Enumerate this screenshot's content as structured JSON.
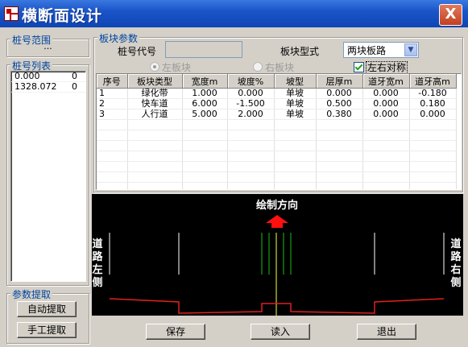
{
  "window": {
    "title": "横断面设计",
    "close_label": "X"
  },
  "left": {
    "stake_range_title": "桩号范围",
    "stake_range_value": "...",
    "stake_list_title": "桩号列表",
    "stake_list": [
      {
        "station": "0.000",
        "value": "0"
      },
      {
        "station": "1328.072",
        "value": "0"
      }
    ],
    "extract_title": "参数提取",
    "auto_extract": "自动提取",
    "manual_extract": "手工提取"
  },
  "params": {
    "title": "板块参数",
    "stake_code_label": "桩号代号",
    "stake_code_value": "",
    "type_label": "板块型式",
    "type_value": "两块板路",
    "left_block": "左板块",
    "right_block": "右板块",
    "symmetric": "左右对称"
  },
  "table": {
    "columns": [
      "序号",
      "板块类型",
      "宽度m",
      "坡度%",
      "坡型",
      "层厚m",
      "道牙宽m",
      "道牙高m"
    ],
    "rows": [
      [
        "1",
        "绿化带",
        "1.000",
        "0.000",
        "单坡",
        "0.000",
        "0.000",
        "-0.180"
      ],
      [
        "2",
        "快车道",
        "6.000",
        "-1.500",
        "单坡",
        "0.500",
        "0.000",
        "0.180"
      ],
      [
        "3",
        "人行道",
        "5.000",
        "2.000",
        "单坡",
        "0.380",
        "0.000",
        "0.000"
      ]
    ]
  },
  "drawing": {
    "direction_label": "绘制方向",
    "left_side": "道路左侧",
    "right_side": "道路右侧",
    "colors": {
      "background": "#000000",
      "profile": "#e02020",
      "guide": "#ffffff",
      "center": "#18c018",
      "arrow": "#ff1010",
      "yellow": "#ffff40"
    }
  },
  "buttons": {
    "save": "保存",
    "read": "读入",
    "exit": "退出"
  }
}
